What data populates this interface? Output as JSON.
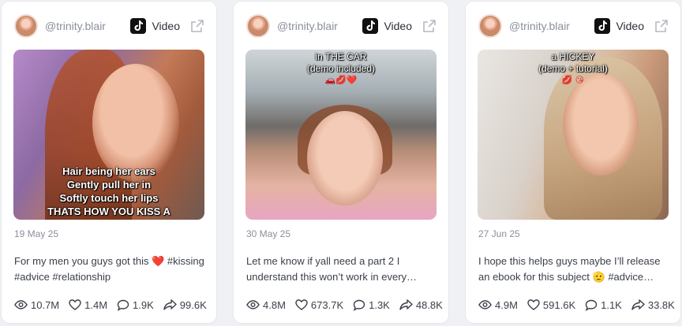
{
  "cards": [
    {
      "username": "@trinity.blair",
      "type_label": "Video",
      "overlay_text": "Hair being her ears\nGently pull her in\nSoftly touch her lips\nTHATS HOW YOU KISS A\nWOMAN",
      "overlay_emoji": "",
      "date": "19 May 25",
      "caption": "For my men you guys got this ❤️ #kissing #advice #relationship",
      "views": "10.7M",
      "likes": "1.4M",
      "comments": "1.9K",
      "shares": "99.6K"
    },
    {
      "username": "@trinity.blair",
      "type_label": "Video",
      "overlay_text": "in THE CAR\n(demo included)",
      "overlay_emoji": "🚗💋❤️",
      "date": "30 May 25",
      "caption": "Let me know if yall need a part 2 I understand this won’t work in every…",
      "views": "4.8M",
      "likes": "673.7K",
      "comments": "1.3K",
      "shares": "48.8K"
    },
    {
      "username": "@trinity.blair",
      "type_label": "Video",
      "overlay_text": "a HICKEY\n(demo + tutorial)",
      "overlay_emoji": "💋 😘",
      "date": "27 Jun 25",
      "caption": "I hope this helps guys maybe I’ll release an ebook for this subject 🫡 #advice…",
      "views": "4.9M",
      "likes": "591.6K",
      "comments": "1.1K",
      "shares": "33.8K"
    }
  ],
  "colors": {
    "accent_text": "#3a3f4a",
    "muted_text": "#8a8f9b",
    "card_bg": "#ffffff",
    "page_bg": "#f0f1f5"
  },
  "icons": {
    "platform": "tiktok-icon",
    "external": "external-link-icon",
    "views": "eye-icon",
    "likes": "heart-icon",
    "comments": "comment-icon",
    "shares": "share-icon"
  }
}
